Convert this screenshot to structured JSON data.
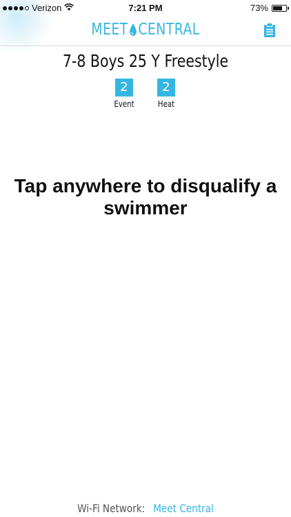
{
  "status_bar": {
    "carrier": "Verizon",
    "time": "7:21 PM",
    "battery_percent": "73%",
    "battery_level": 0.73,
    "signal_bars_filled": 4,
    "signal_bars_total": 5
  },
  "nav": {
    "logo_left": "MEET",
    "logo_right": "CENTRAL",
    "clipboard_icon": "clipboard-icon"
  },
  "event": {
    "title": "7-8 Boys 25 Y Freestyle",
    "event_number": "2",
    "event_label": "Event",
    "heat_number": "2",
    "heat_label": "Heat"
  },
  "main": {
    "prompt": "Tap anywhere to disqualify a swimmer"
  },
  "footer": {
    "network_label": "Wi-Fi Network:",
    "network_name": "Meet Central"
  },
  "colors": {
    "accent": "#35b6e2"
  }
}
